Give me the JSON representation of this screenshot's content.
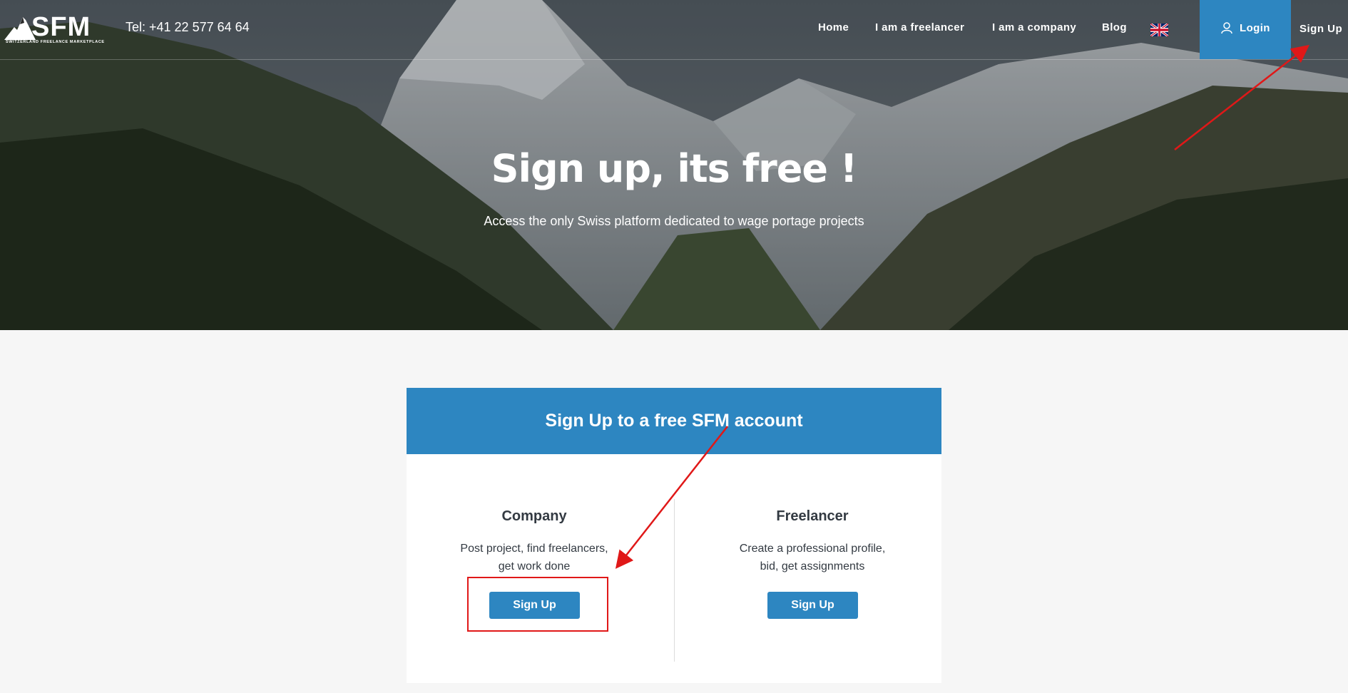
{
  "header": {
    "logo_text": "SFM",
    "logo_tagline": "SWITZERLAND FREELANCE MARKETPLACE",
    "tel": "Tel: +41 22 577 64 64",
    "nav": [
      "Home",
      "I am a freelancer",
      "I am a company",
      "Blog"
    ],
    "language_flag": "uk-flag-icon",
    "login_label": "Login",
    "signup_label": "Sign Up"
  },
  "hero": {
    "title": "Sign up, its free !",
    "subtitle": "Access the only Swiss platform dedicated to wage portage projects"
  },
  "card": {
    "header": "Sign Up to a free SFM account",
    "company": {
      "title": "Company",
      "desc_line1": "Post project, find freelancers,",
      "desc_line2": "get work done",
      "button": "Sign Up"
    },
    "freelancer": {
      "title": "Freelancer",
      "desc_line1": "Create a professional profile,",
      "desc_line2": "bid, get assignments",
      "button": "Sign Up"
    }
  },
  "colors": {
    "accent": "#2d86c1",
    "annotation": "#e01818",
    "page_bg": "#f6f6f6"
  }
}
